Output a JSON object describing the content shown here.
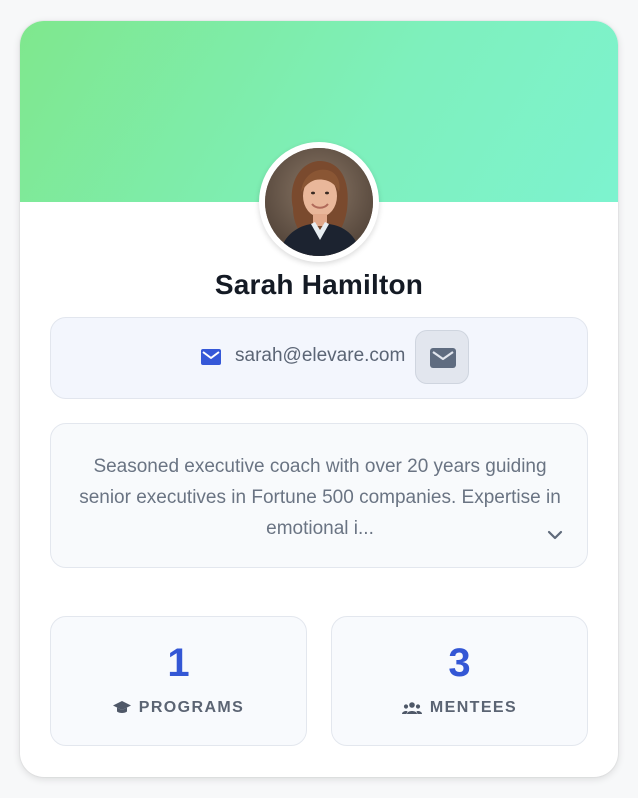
{
  "profile": {
    "name": "Sarah Hamilton",
    "email": "sarah@elevare.com",
    "bio": "Seasoned executive coach with over 20 years guiding senior executives in Fortune 500 companies. Expertise in emotional i...",
    "avatar_icon": "person-photo"
  },
  "actions": {
    "email_button_icon": "mail-icon",
    "expand_bio_icon": "chevron-down-icon"
  },
  "stats": [
    {
      "value": "1",
      "label": "PROGRAMS",
      "icon": "graduation-cap-icon"
    },
    {
      "value": "3",
      "label": "MENTEES",
      "icon": "group-icon"
    }
  ],
  "colors": {
    "banner_start": "#7fe78d",
    "banner_end": "#7df3cf",
    "accent": "#3457d5",
    "name_text": "#141a24",
    "muted_text": "#5b6575"
  }
}
